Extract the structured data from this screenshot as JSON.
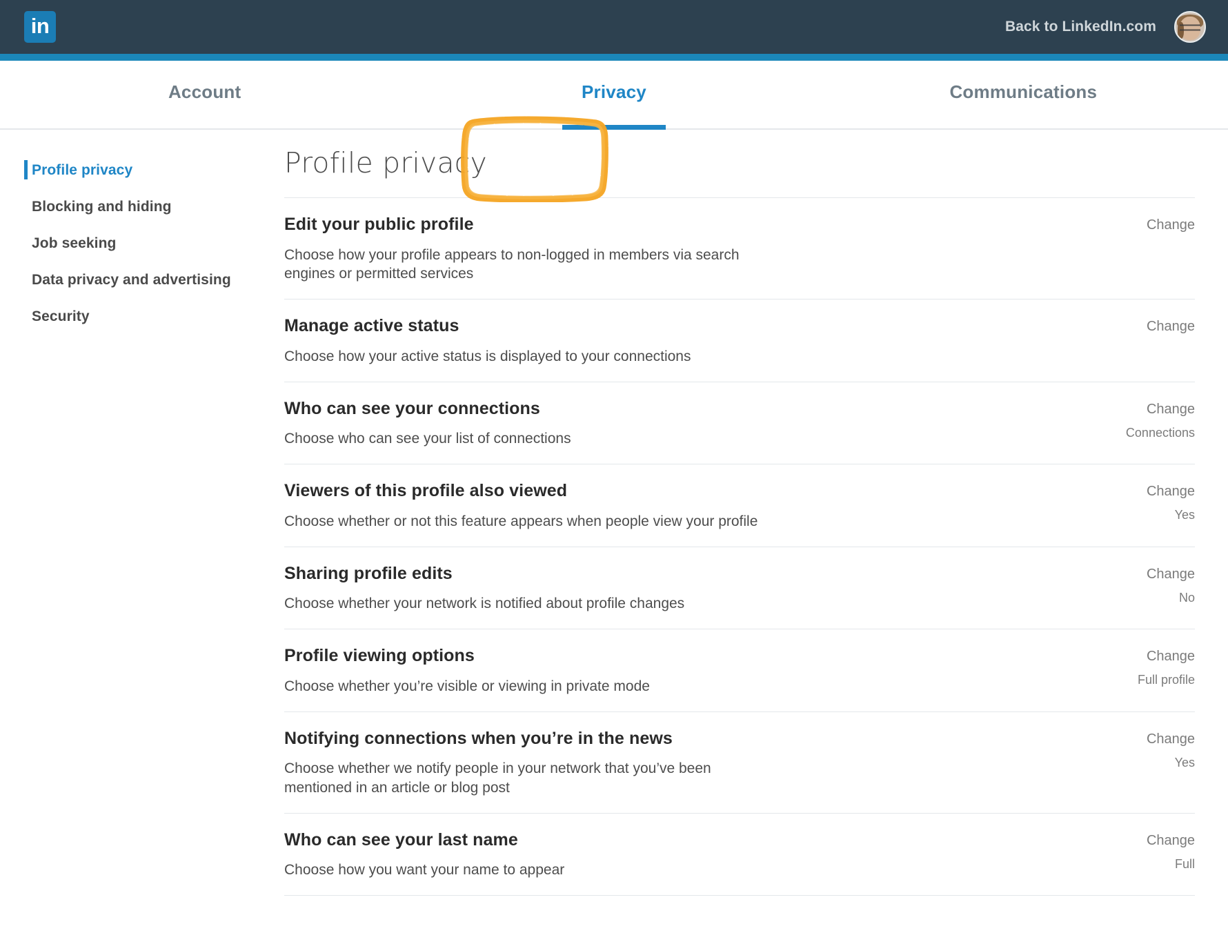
{
  "header": {
    "logo_text": "in",
    "back_label": "Back to LinkedIn.com",
    "avatar_name": "profile-avatar"
  },
  "tabs": [
    {
      "label": "Account",
      "active": false
    },
    {
      "label": "Privacy",
      "active": true
    },
    {
      "label": "Communications",
      "active": false
    }
  ],
  "annotation": {
    "color": "#f5a524",
    "target": "Privacy"
  },
  "sidebar": {
    "items": [
      {
        "label": "Profile privacy",
        "active": true
      },
      {
        "label": "Blocking and hiding",
        "active": false
      },
      {
        "label": "Job seeking",
        "active": false
      },
      {
        "label": "Data privacy and advertising",
        "active": false
      },
      {
        "label": "Security",
        "active": false
      }
    ]
  },
  "main": {
    "page_title": "Profile privacy",
    "change_label": "Change",
    "settings": [
      {
        "title": "Edit your public profile",
        "desc": "Choose how your profile appears to non-logged in members via search engines or permitted services",
        "change": "Change",
        "value": ""
      },
      {
        "title": "Manage active status",
        "desc": "Choose how your active status is displayed to your connections",
        "change": "Change",
        "value": ""
      },
      {
        "title": "Who can see your connections",
        "desc": "Choose who can see your list of connections",
        "change": "Change",
        "value": "Connections"
      },
      {
        "title": "Viewers of this profile also viewed",
        "desc": "Choose whether or not this feature appears when people view your profile",
        "change": "Change",
        "value": "Yes"
      },
      {
        "title": "Sharing profile edits",
        "desc": "Choose whether your network is notified about profile changes",
        "change": "Change",
        "value": "No"
      },
      {
        "title": "Profile viewing options",
        "desc": "Choose whether you’re visible or viewing in private mode",
        "change": "Change",
        "value": "Full profile"
      },
      {
        "title": "Notifying connections when you’re in the news",
        "desc": "Choose whether we notify people in your network that you’ve been mentioned in an article or blog post",
        "change": "Change",
        "value": "Yes"
      },
      {
        "title": "Who can see your last name",
        "desc": "Choose how you want your name to appear",
        "change": "Change",
        "value": "Full"
      }
    ]
  },
  "colors": {
    "topbar_bg": "#2d4150",
    "strip_blue": "#1b87b9",
    "accent_blue": "#1f86c6",
    "annotation_orange": "#f5a524"
  }
}
